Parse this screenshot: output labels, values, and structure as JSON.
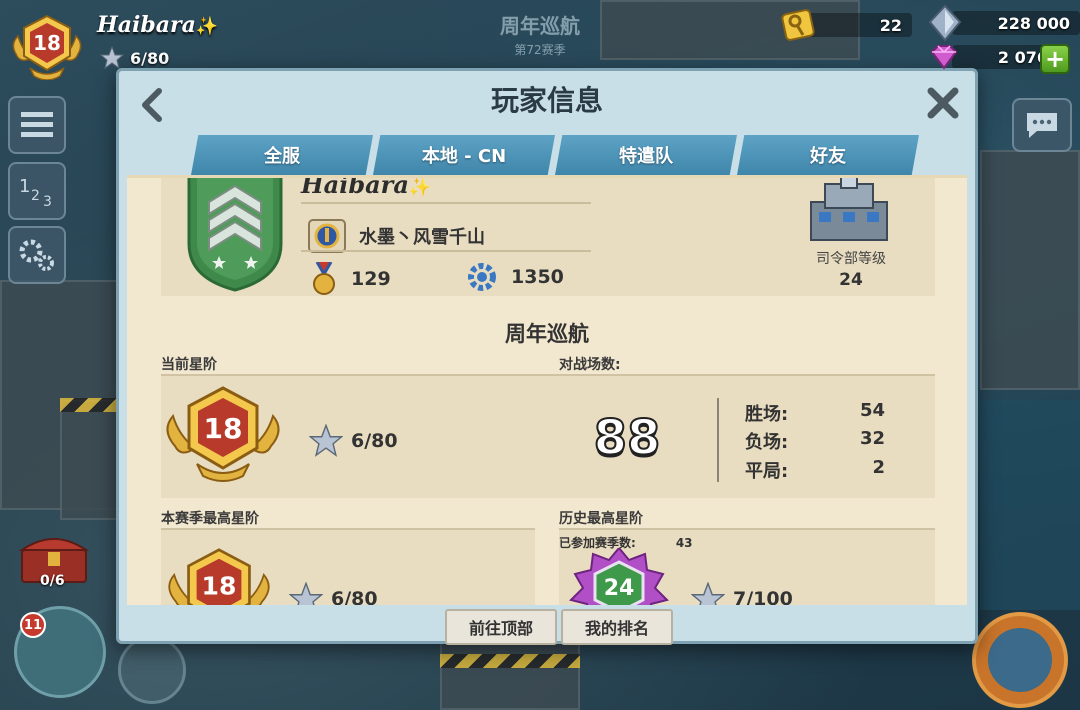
{
  "hud": {
    "rank_level": "18",
    "player_name": "Haibara",
    "player_sparkle": "✨",
    "stars": "6/80",
    "season_title": "周年巡航",
    "season_subtitle": "第72赛季",
    "keys": "22",
    "diamonds": "228 000",
    "gems": "2 076",
    "plus_label": "+",
    "chest_count": "0/6",
    "troop_badge": "11"
  },
  "panel": {
    "title": "玩家信息",
    "tabs": [
      {
        "label": "全服"
      },
      {
        "label": "本地 - CN"
      },
      {
        "label": "特遣队"
      },
      {
        "label": "好友"
      }
    ],
    "profile": {
      "name": "Haibara",
      "sparkle": "✨",
      "guild": "水墨丶风雪千山",
      "medals": "129",
      "parts": "1350",
      "hq_label": "司令部等级",
      "hq_level": "24"
    },
    "season_name": "周年巡航",
    "current_rank_label": "当前星阶",
    "current_rank": "18",
    "current_stars": "6/80",
    "battles_label": "对战场数:",
    "battles": "88",
    "wins_label": "胜场:",
    "wins": "54",
    "losses_label": "负场:",
    "losses": "32",
    "draws_label": "平局:",
    "draws": "2",
    "season_best_label": "本赛季最高星阶",
    "season_best_rank": "18",
    "season_best_stars": "6/80",
    "alltime_best_label": "历史最高星阶",
    "seasons_played_label": "已参加赛季数:",
    "seasons_played": "43",
    "alltime_best_rank": "24",
    "alltime_best_stars": "7/100",
    "goto_top_button": "前往顶部",
    "my_rank_button": "我的排名"
  },
  "colors": {
    "tab_blue": "#4f95b8",
    "paper": "#f2e7cf",
    "rank_red": "#b73a2a",
    "gold": "#e3b340",
    "purple_badge": "#b04fc6",
    "green_plus": "#6bbb34"
  }
}
